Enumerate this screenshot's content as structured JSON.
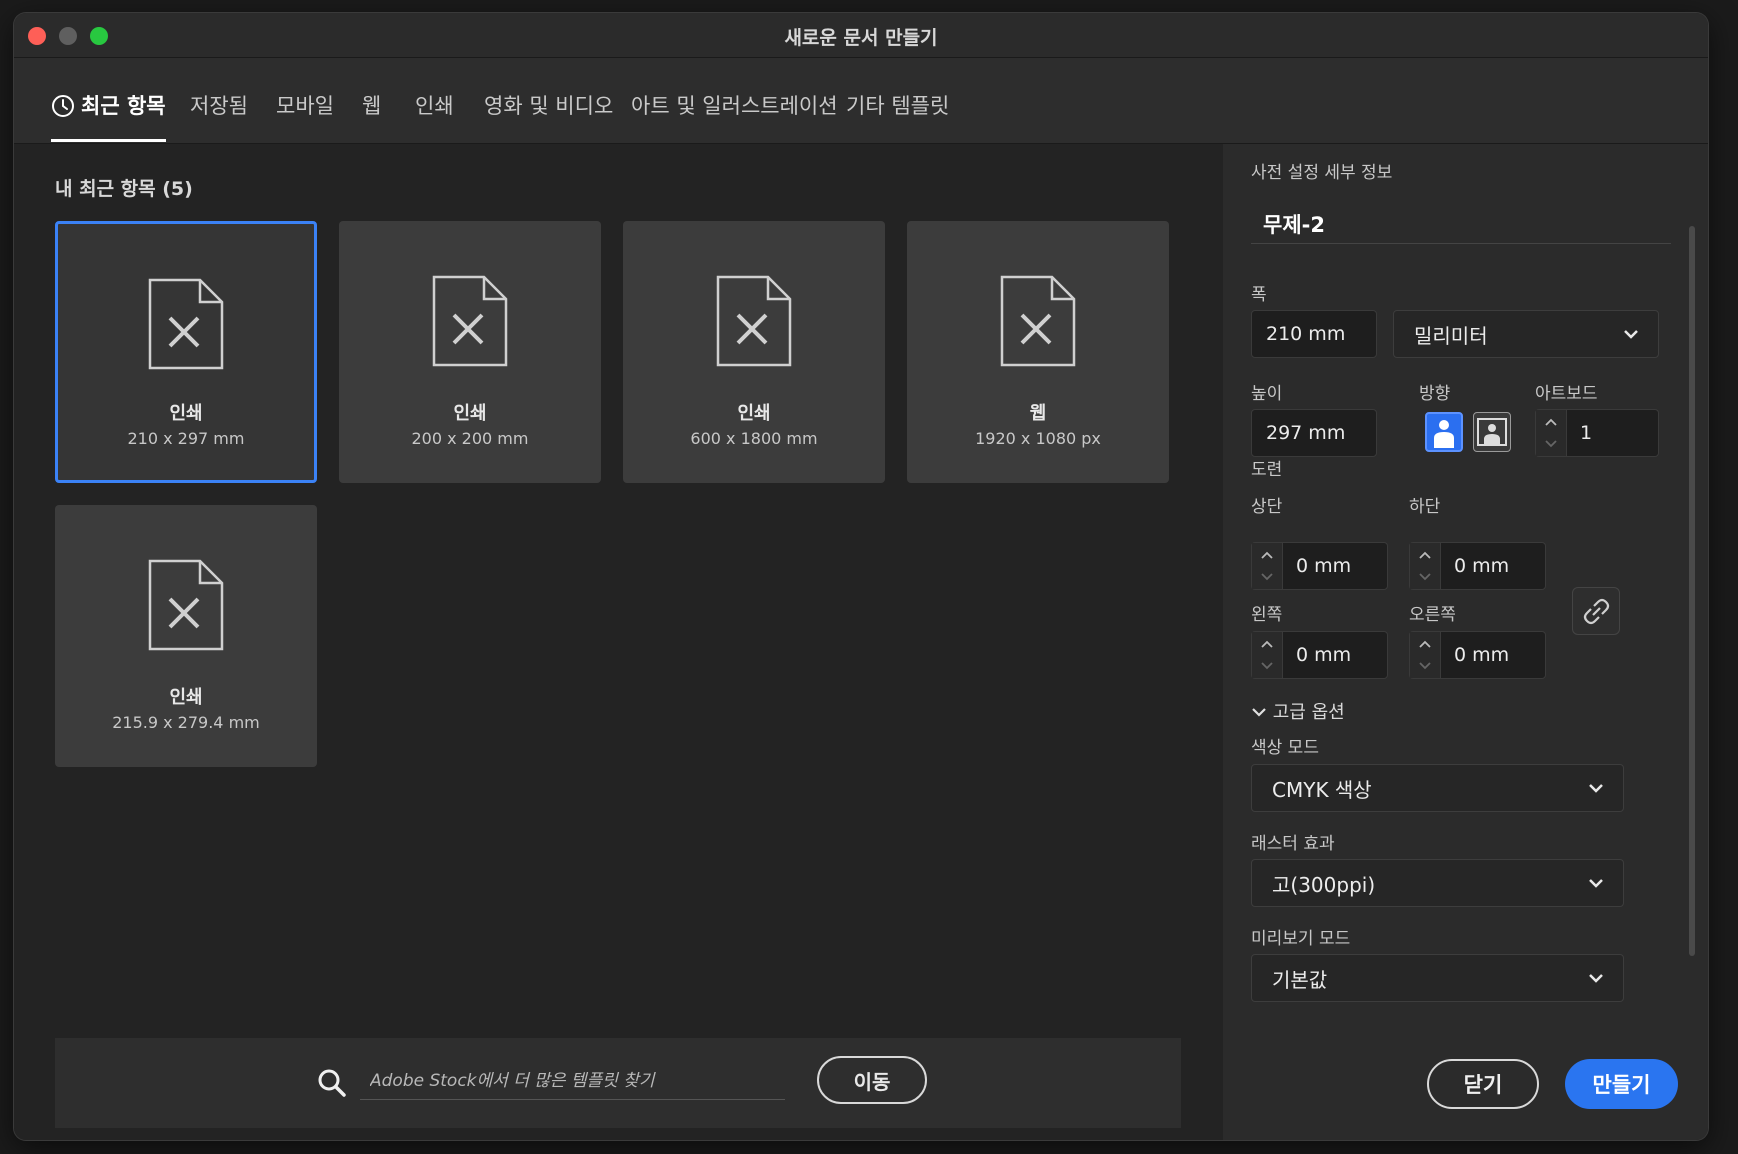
{
  "window": {
    "title": "새로운 문서 만들기"
  },
  "tabs": [
    {
      "label": "최근 항목"
    },
    {
      "label": "저장됨"
    },
    {
      "label": "모바일"
    },
    {
      "label": "웹"
    },
    {
      "label": "인쇄"
    },
    {
      "label": "영화 및 비디오"
    },
    {
      "label": "아트 및 일러스트레이션"
    },
    {
      "label": "기타 템플릿"
    }
  ],
  "recent": {
    "title": "내 최근 항목 (5)",
    "items": [
      {
        "category": "인쇄",
        "size": "210 x 297 mm"
      },
      {
        "category": "인쇄",
        "size": "200 x 200 mm"
      },
      {
        "category": "인쇄",
        "size": "600 x 1800 mm"
      },
      {
        "category": "웹",
        "size": "1920 x 1080 px"
      },
      {
        "category": "인쇄",
        "size": "215.9 x 279.4 mm"
      }
    ]
  },
  "search": {
    "placeholder": "Adobe Stock에서 더 많은 템플릿 찾기",
    "button": "이동"
  },
  "preset": {
    "header": "사전 설정 세부 정보",
    "name": "무제-2",
    "width_label": "폭",
    "width": "210 mm",
    "unit": "밀리미터",
    "height_label": "높이",
    "height": "297 mm",
    "orientation_label": "방향",
    "artboard_label": "아트보드",
    "artboards": "1",
    "bleed_label": "도련",
    "top_label": "상단",
    "top": "0 mm",
    "bottom_label": "하단",
    "bottom": "0 mm",
    "left_label": "왼쪽",
    "left": "0 mm",
    "right_label": "오른쪽",
    "right": "0 mm",
    "advanced_label": "고급 옵션",
    "color_mode_label": "색상 모드",
    "color_mode": "CMYK 색상",
    "raster_label": "래스터 효과",
    "raster": "고(300ppi)",
    "preview_label": "미리보기 모드",
    "preview": "기본값"
  },
  "actions": {
    "close": "닫기",
    "create": "만들기"
  },
  "colors": {
    "accent": "#2a75f0",
    "selection": "#3b82f6",
    "bg": "#232323",
    "panel": "#2b2b2b"
  }
}
